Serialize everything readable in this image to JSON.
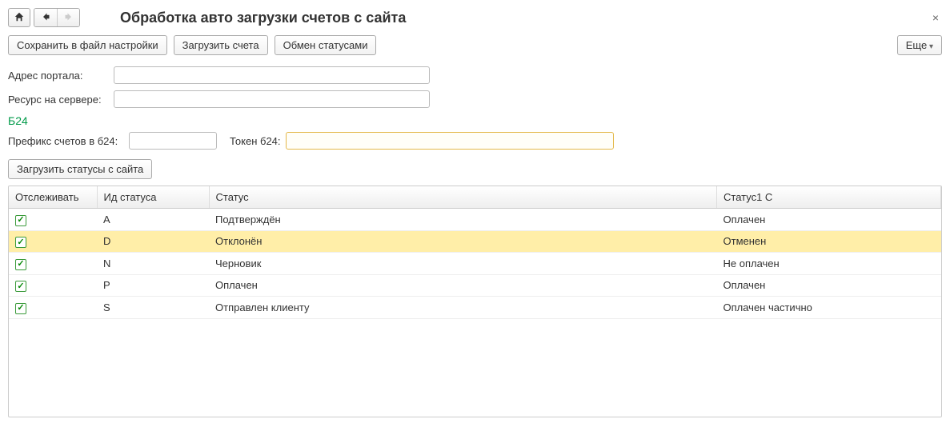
{
  "header": {
    "title": "Обработка авто загрузки счетов с сайта"
  },
  "toolbar": {
    "save_settings_label": "Сохранить в файл настройки",
    "load_invoices_label": "Загрузить счета",
    "exchange_status_label": "Обмен статусами",
    "more_label": "Еще"
  },
  "form": {
    "portal_address_label": "Адрес портала:",
    "portal_address_value": "",
    "server_resource_label": "Ресурс на сервере:",
    "server_resource_value": ""
  },
  "b24": {
    "section_title": "Б24",
    "prefix_label": "Префикс счетов в б24:",
    "prefix_value": "",
    "token_label": "Токен б24:",
    "token_value": "",
    "load_statuses_label": "Загрузить статусы с сайта"
  },
  "table": {
    "headers": {
      "track": "Отслеживать",
      "id": "Ид статуса",
      "status": "Статус",
      "status1c": "Статус1 С"
    },
    "rows": [
      {
        "track": true,
        "id": "A",
        "status": "Подтверждён",
        "status1c": "Оплачен",
        "selected": false
      },
      {
        "track": true,
        "id": "D",
        "status": "Отклонён",
        "status1c": "Отменен",
        "selected": true
      },
      {
        "track": true,
        "id": "N",
        "status": "Черновик",
        "status1c": "Не оплачен",
        "selected": false
      },
      {
        "track": true,
        "id": "P",
        "status": "Оплачен",
        "status1c": "Оплачен",
        "selected": false
      },
      {
        "track": true,
        "id": "S",
        "status": "Отправлен клиенту",
        "status1c": "Оплачен частично",
        "selected": false
      }
    ]
  }
}
